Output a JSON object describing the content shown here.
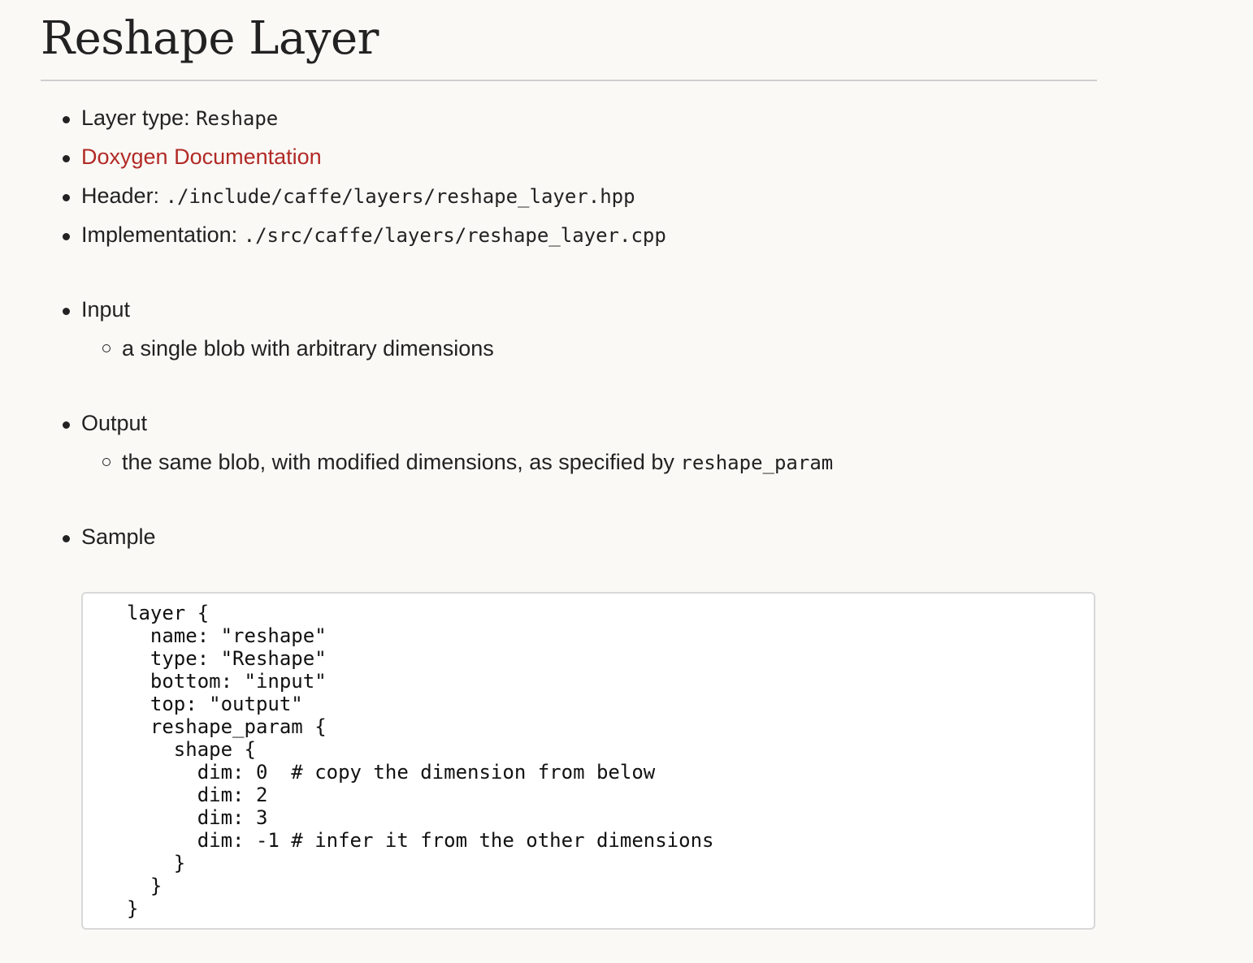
{
  "title": "Reshape Layer",
  "info": {
    "layer_type_label": "Layer type:",
    "layer_type_value": "Reshape",
    "doxygen_link": "Doxygen Documentation",
    "header_label": "Header:",
    "header_value": "./include/caffe/layers/reshape_layer.hpp",
    "impl_label": "Implementation:",
    "impl_value": "./src/caffe/layers/reshape_layer.cpp"
  },
  "input": {
    "label": "Input",
    "desc": "a single blob with arbitrary dimensions"
  },
  "output": {
    "label": "Output",
    "desc_prefix": "the same blob, with modified dimensions, as specified by",
    "desc_code": "reshape_param"
  },
  "sample": {
    "label": "Sample",
    "code": "layer {\n  name: \"reshape\"\n  type: \"Reshape\"\n  bottom: \"input\"\n  top: \"output\"\n  reshape_param {\n    shape {\n      dim: 0  # copy the dimension from below\n      dim: 2\n      dim: 3\n      dim: -1 # infer it from the other dimensions\n    }\n  }\n}"
  },
  "colors": {
    "link": "#b22a25",
    "background": "#faf9f6",
    "text": "#222222"
  }
}
